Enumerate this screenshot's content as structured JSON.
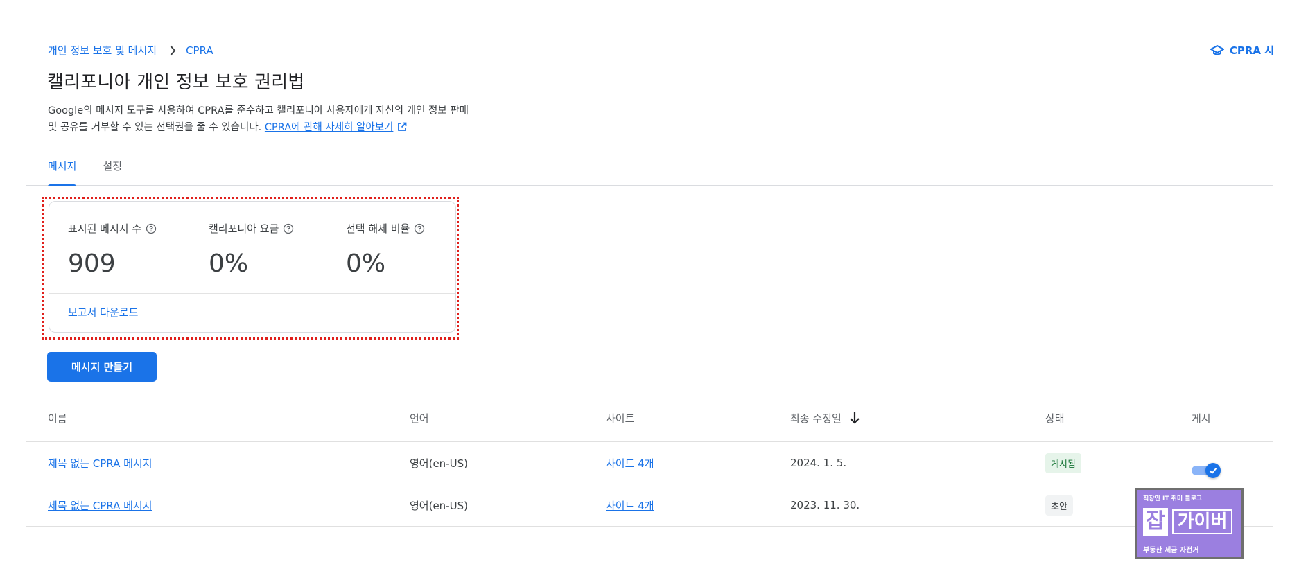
{
  "breadcrumb": {
    "parent": "개인 정보 보호 및 메시지",
    "current": "CPRA"
  },
  "top_right_link": "CPRA 시",
  "page_title": "캘리포니아 개인 정보 보호 권리법",
  "description": {
    "line1": "Google의 메시지 도구를 사용하여 CPRA를 준수하고 캘리포니아 사용자에게 자신의 개인 정보 판매",
    "line2": "및 공유를 거부할 수 있는 선택권을 줄 수 있습니다. ",
    "link": "CPRA에 관해 자세히 알아보기"
  },
  "tabs": [
    {
      "label": "메시지",
      "active": true
    },
    {
      "label": "설정",
      "active": false
    }
  ],
  "stats": [
    {
      "label": "표시된 메시지 수",
      "value": "909"
    },
    {
      "label": "캘리포니아 요금",
      "value": "0%"
    },
    {
      "label": "선택 해제 비율",
      "value": "0%"
    }
  ],
  "download_label": "보고서 다운로드",
  "create_button": "메시지 만들기",
  "table": {
    "headers": {
      "name": "이름",
      "language": "언어",
      "site": "사이트",
      "last_modified": "최종 수정일",
      "status": "상태",
      "publish": "게시"
    },
    "rows": [
      {
        "name": "제목 없는 CPRA 메시지",
        "language": "영어(en-US)",
        "site": "사이트 4개",
        "date": "2024. 1. 5.",
        "status": "게시됨",
        "published": true
      },
      {
        "name": "제목 없는 CPRA 메시지",
        "language": "영어(en-US)",
        "site": "사이트 4개",
        "date": "2023. 11. 30.",
        "status": "초안",
        "published": false
      }
    ]
  },
  "watermark": {
    "top": "직장인 IT 취미 블로그",
    "big1": "잡",
    "big2": "가이버",
    "bottom": "부동산 세금 자전거"
  },
  "colors": {
    "accent": "#1a73e8",
    "highlight_border": "#e0201c",
    "published_badge_bg": "#e6f4ea",
    "published_badge_text": "#137333",
    "draft_badge_bg": "#f1f3f4",
    "watermark_bg": "#9b7fe0"
  },
  "icons": {
    "breadcrumb_separator": "chevron-right-icon",
    "top_right": "school-cap-icon",
    "external_link": "open-in-new-icon",
    "help": "help-circle-icon",
    "sort": "arrow-down-icon",
    "toggle_check": "check-icon"
  }
}
